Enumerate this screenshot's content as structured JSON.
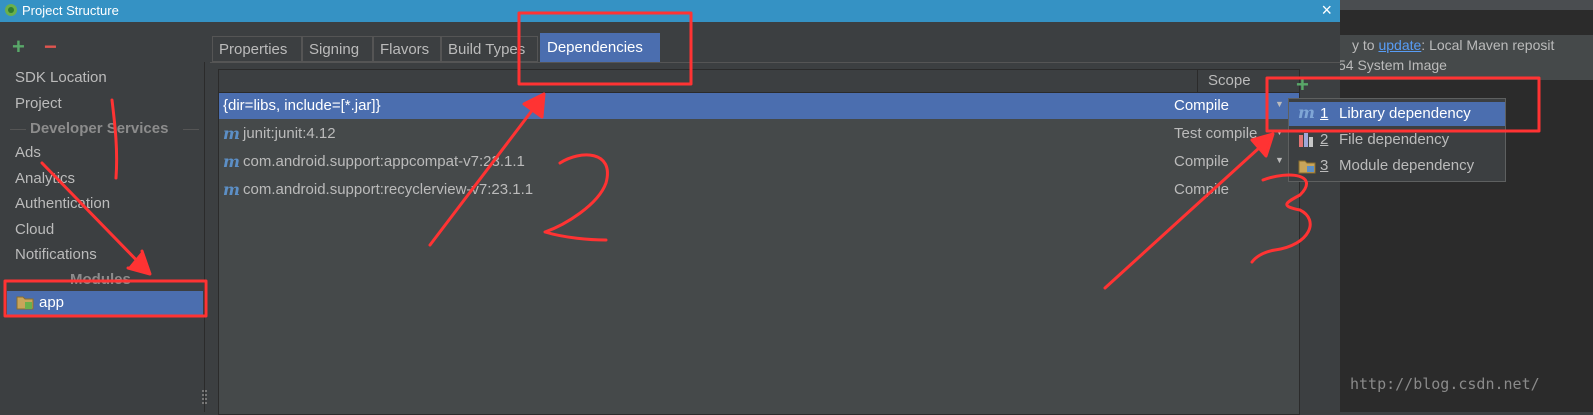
{
  "window": {
    "title": "Project Structure",
    "close_glyph": "×"
  },
  "left_panel": {
    "add_glyph": "+",
    "remove_glyph": "−",
    "items_top": [
      "SDK Location",
      "Project"
    ],
    "developer_services_header": "Developer Services",
    "services": [
      "Ads",
      "Analytics",
      "Authentication",
      "Cloud",
      "Notifications"
    ],
    "modules_header": "Modules",
    "module": "app"
  },
  "tabs": [
    "Properties",
    "Signing",
    "Flavors",
    "Build Types",
    "Dependencies"
  ],
  "active_tab": "Dependencies",
  "table": {
    "scope_header": "Scope",
    "rows": [
      {
        "name": "{dir=libs, include=[*.jar]}",
        "scope": "Compile",
        "icon": "none",
        "selected": true
      },
      {
        "name": "junit:junit:4.12",
        "scope": "Test compile",
        "icon": "maven-m-icon",
        "selected": false
      },
      {
        "name": "com.android.support:appcompat-v7:23.1.1",
        "scope": "Compile",
        "icon": "maven-m-icon",
        "selected": false
      },
      {
        "name": "com.android.support:recyclerview-v7:23.1.1",
        "scope": "Compile",
        "icon": "maven-m-icon",
        "selected": false
      }
    ],
    "add_glyph": "+"
  },
  "popup": {
    "items": [
      {
        "num": "1",
        "label": "Library dependency",
        "icon": "maven-m-icon",
        "selected": true
      },
      {
        "num": "2",
        "label": "File dependency",
        "icon": "jar-file-icon",
        "selected": false
      },
      {
        "num": "3",
        "label": "Module dependency",
        "icon": "module-folder-icon",
        "selected": false
      }
    ]
  },
  "background_window": {
    "notice_prefix": "y to ",
    "notice_link": "update",
    "notice_suffix": ": Local Maven reposit",
    "notice_line2": "54 System Image",
    "watermark": "http://blog.csdn.net/"
  },
  "colors": {
    "accent": "#4b6eaf",
    "annotation": "#ff3333",
    "add_green": "#59a869",
    "remove_red": "#e0554f"
  }
}
